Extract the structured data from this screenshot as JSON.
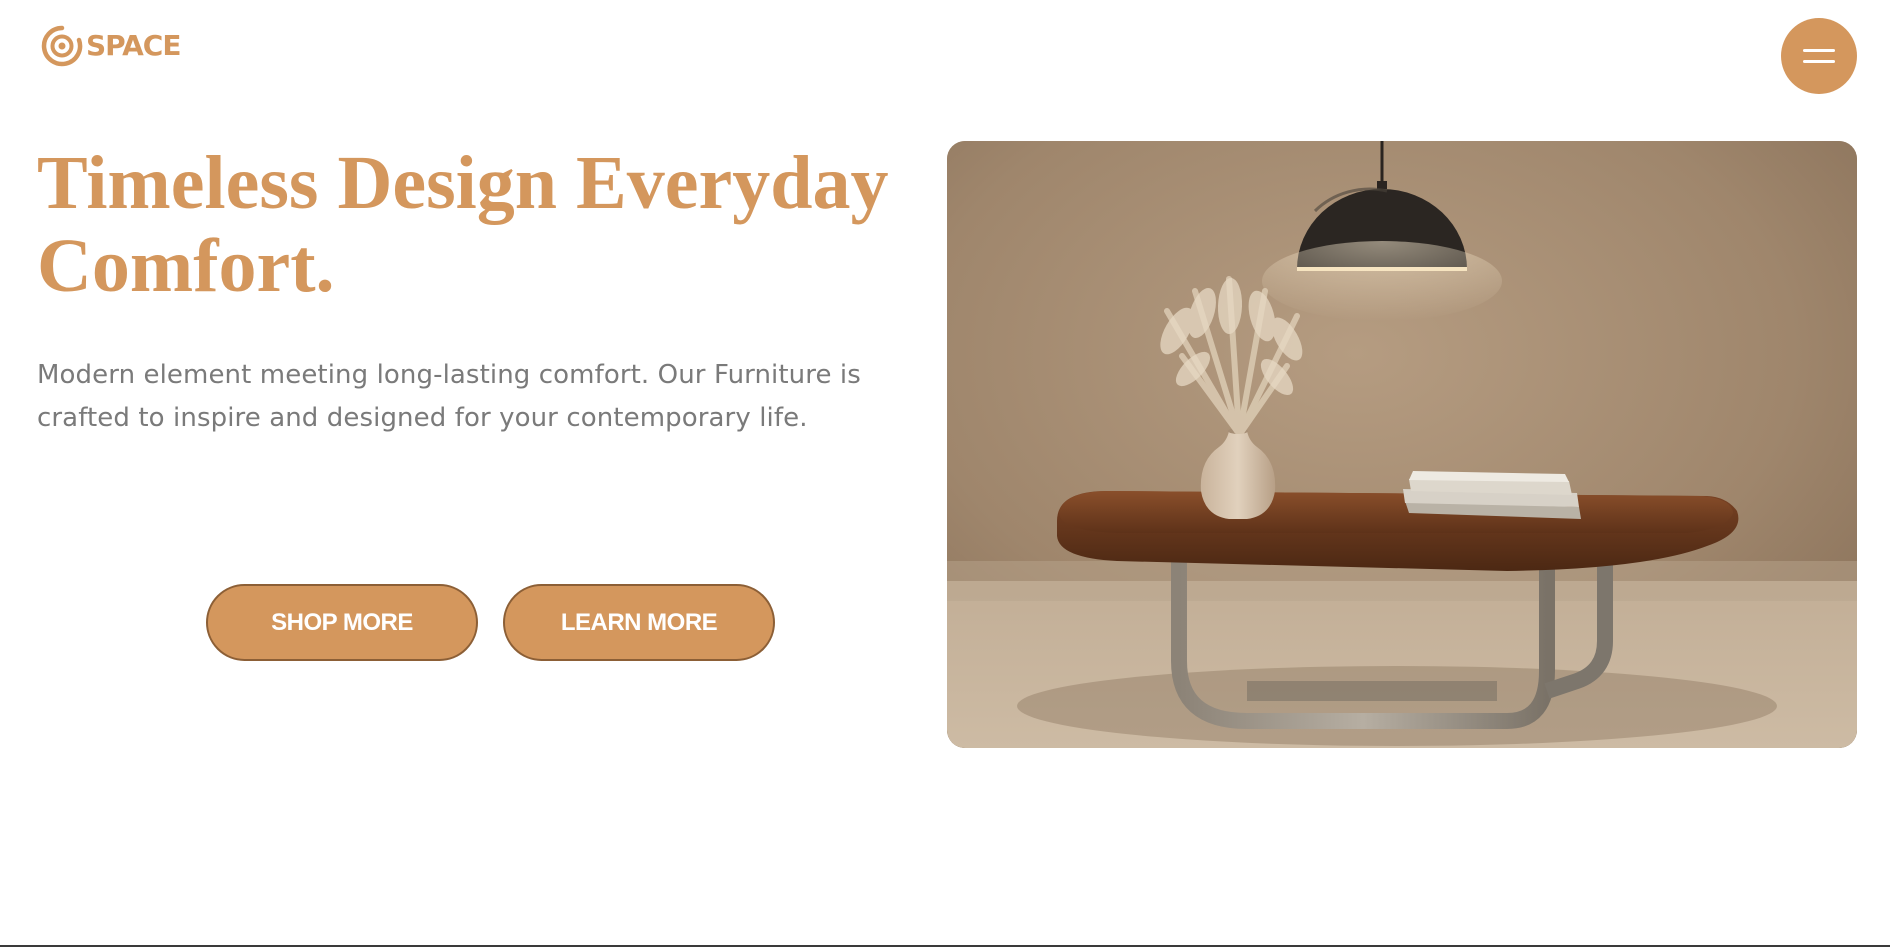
{
  "header": {
    "logo_text": "SPACE",
    "logo_icon": "concentric-circle-logo-icon",
    "menu_icon": "hamburger-menu-icon"
  },
  "hero": {
    "title": "Timeless Design Everyday Comfort.",
    "subtitle": "Modern element meeting long-lasting comfort. Our Furniture is crafted to inspire and designed for your contemporary life.",
    "buttons": {
      "shop_label": "SHOP MORE",
      "learn_label": "LEARN MORE"
    },
    "image": {
      "subject": "coffee-table-with-pendant-lamp-vase-and-books"
    }
  },
  "colors": {
    "accent": "#d4975d",
    "button_border": "#8c5f36",
    "body_text": "#7a7a7a",
    "background": "#ffffff"
  }
}
